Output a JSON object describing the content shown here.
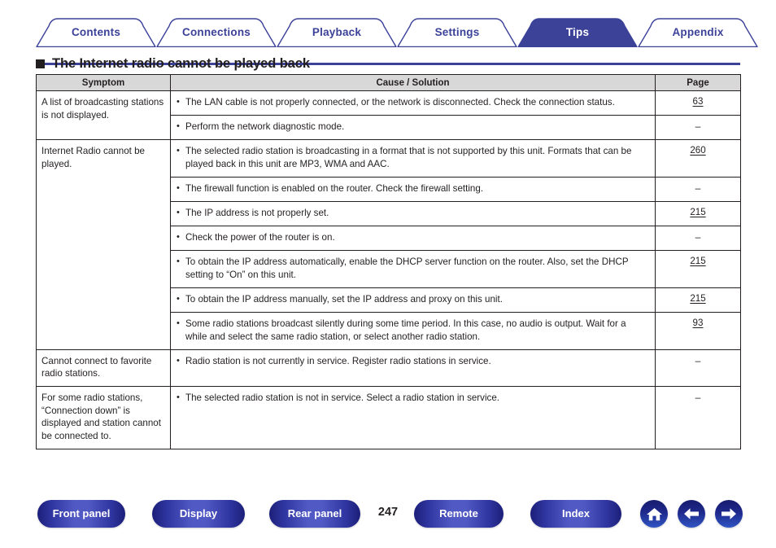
{
  "tabs": [
    {
      "label": "Contents",
      "active": false
    },
    {
      "label": "Connections",
      "active": false
    },
    {
      "label": "Playback",
      "active": false
    },
    {
      "label": "Settings",
      "active": false
    },
    {
      "label": "Tips",
      "active": true
    },
    {
      "label": "Appendix",
      "active": false
    }
  ],
  "heading": {
    "text": "The Internet radio cannot be played back"
  },
  "table": {
    "headers": {
      "symptom": "Symptom",
      "cause": "Cause / Solution",
      "page": "Page"
    },
    "rows": [
      {
        "symptom": "A list of broadcasting stations is not displayed.",
        "causes": [
          {
            "text": "The LAN cable is not properly connected, or the network is disconnected. Check the connection status.",
            "page": "63",
            "page_is_link": true
          },
          {
            "text": "Perform the network diagnostic mode.",
            "page": "–",
            "page_is_link": false
          }
        ]
      },
      {
        "symptom": "Internet Radio cannot be played.",
        "causes": [
          {
            "text": "The selected radio station is broadcasting in a format that is not supported by this unit. Formats that can be played back in this unit are MP3, WMA and AAC.",
            "page": "260",
            "page_is_link": true
          },
          {
            "text": "The firewall function is enabled on the router. Check the firewall setting.",
            "page": "–",
            "page_is_link": false
          },
          {
            "text": "The IP address is not properly set.",
            "page": "215",
            "page_is_link": true
          },
          {
            "text": "Check the power of the router is on.",
            "page": "–",
            "page_is_link": false
          },
          {
            "text": "To obtain the IP address automatically, enable the DHCP server function on the router. Also, set the DHCP setting to “On” on this unit.",
            "page": "215",
            "page_is_link": true
          },
          {
            "text": "To obtain the IP address manually, set the IP address and proxy on this unit.",
            "page": "215",
            "page_is_link": true
          },
          {
            "text": "Some radio stations broadcast silently during some time period. In this case, no audio is output. Wait for a while and select the same radio station, or select another radio station.",
            "page": "93",
            "page_is_link": true
          }
        ]
      },
      {
        "symptom": "Cannot connect to favorite radio stations.",
        "causes": [
          {
            "text": "Radio station is not currently in service. Register radio stations in service.",
            "page": "–",
            "page_is_link": false
          }
        ]
      },
      {
        "symptom": "For some radio stations, “Connection down” is displayed and station cannot be connected to.",
        "causes": [
          {
            "text": "The selected radio station is not in service. Select a radio station in service.",
            "page": "–",
            "page_is_link": false
          }
        ]
      }
    ]
  },
  "footer": {
    "buttons": [
      {
        "label": "Front panel"
      },
      {
        "label": "Display"
      },
      {
        "label": "Rear panel"
      },
      {
        "label": "Remote"
      },
      {
        "label": "Index"
      }
    ],
    "page_number": "247",
    "icons": [
      {
        "name": "home-icon"
      },
      {
        "name": "arrow-left-icon"
      },
      {
        "name": "arrow-right-icon"
      }
    ]
  },
  "colors": {
    "accent": "#3b4298",
    "tab_active_bg": "#3b4298",
    "header_bg": "#d8d8d8",
    "text": "#231f20"
  }
}
